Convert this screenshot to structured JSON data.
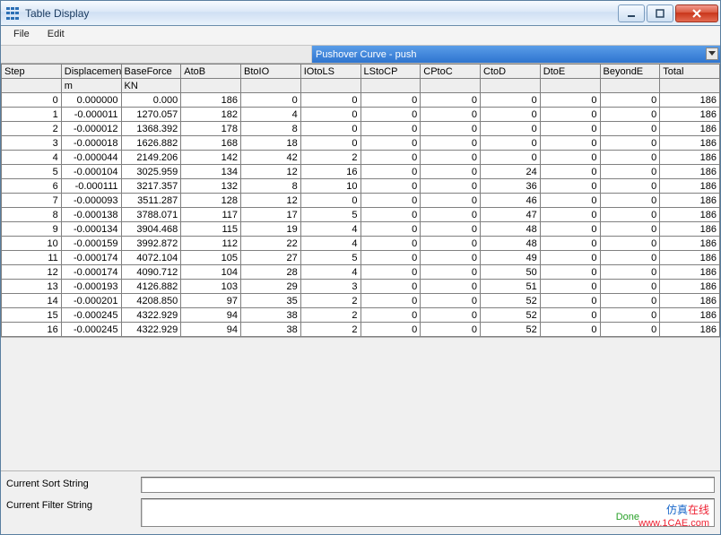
{
  "window": {
    "title": "Table Display"
  },
  "menu": {
    "file": "File",
    "edit": "Edit"
  },
  "selector": {
    "label": "Pushover Curve - push"
  },
  "columns": [
    "Step",
    "Displacemen",
    "BaseForce",
    "AtoB",
    "BtoIO",
    "IOtoLS",
    "LStoCP",
    "CPtoC",
    "CtoD",
    "DtoE",
    "BeyondE",
    "Total"
  ],
  "units": [
    "",
    "m",
    "KN",
    "",
    "",
    "",
    "",
    "",
    "",
    "",
    "",
    ""
  ],
  "rows": [
    [
      "0",
      "0.000000",
      "0.000",
      "186",
      "0",
      "0",
      "0",
      "0",
      "0",
      "0",
      "0",
      "186"
    ],
    [
      "1",
      "-0.000011",
      "1270.057",
      "182",
      "4",
      "0",
      "0",
      "0",
      "0",
      "0",
      "0",
      "186"
    ],
    [
      "2",
      "-0.000012",
      "1368.392",
      "178",
      "8",
      "0",
      "0",
      "0",
      "0",
      "0",
      "0",
      "186"
    ],
    [
      "3",
      "-0.000018",
      "1626.882",
      "168",
      "18",
      "0",
      "0",
      "0",
      "0",
      "0",
      "0",
      "186"
    ],
    [
      "4",
      "-0.000044",
      "2149.206",
      "142",
      "42",
      "2",
      "0",
      "0",
      "0",
      "0",
      "0",
      "186"
    ],
    [
      "5",
      "-0.000104",
      "3025.959",
      "134",
      "12",
      "16",
      "0",
      "0",
      "24",
      "0",
      "0",
      "186"
    ],
    [
      "6",
      "-0.000111",
      "3217.357",
      "132",
      "8",
      "10",
      "0",
      "0",
      "36",
      "0",
      "0",
      "186"
    ],
    [
      "7",
      "-0.000093",
      "3511.287",
      "128",
      "12",
      "0",
      "0",
      "0",
      "46",
      "0",
      "0",
      "186"
    ],
    [
      "8",
      "-0.000138",
      "3788.071",
      "117",
      "17",
      "5",
      "0",
      "0",
      "47",
      "0",
      "0",
      "186"
    ],
    [
      "9",
      "-0.000134",
      "3904.468",
      "115",
      "19",
      "4",
      "0",
      "0",
      "48",
      "0",
      "0",
      "186"
    ],
    [
      "10",
      "-0.000159",
      "3992.872",
      "112",
      "22",
      "4",
      "0",
      "0",
      "48",
      "0",
      "0",
      "186"
    ],
    [
      "11",
      "-0.000174",
      "4072.104",
      "105",
      "27",
      "5",
      "0",
      "0",
      "49",
      "0",
      "0",
      "186"
    ],
    [
      "12",
      "-0.000174",
      "4090.712",
      "104",
      "28",
      "4",
      "0",
      "0",
      "50",
      "0",
      "0",
      "186"
    ],
    [
      "13",
      "-0.000193",
      "4126.882",
      "103",
      "29",
      "3",
      "0",
      "0",
      "51",
      "0",
      "0",
      "186"
    ],
    [
      "14",
      "-0.000201",
      "4208.850",
      "97",
      "35",
      "2",
      "0",
      "0",
      "52",
      "0",
      "0",
      "186"
    ],
    [
      "15",
      "-0.000245",
      "4322.929",
      "94",
      "38",
      "2",
      "0",
      "0",
      "52",
      "0",
      "0",
      "186"
    ],
    [
      "16",
      "-0.000245",
      "4322.929",
      "94",
      "38",
      "2",
      "0",
      "0",
      "52",
      "0",
      "0",
      "186"
    ]
  ],
  "bottom": {
    "sort_label": "Current Sort String",
    "filter_label": "Current Filter String",
    "sort_value": "",
    "filter_value": ""
  },
  "status": {
    "done": "Done"
  },
  "watermark": {
    "line1_a": "仿真",
    "line1_b": "在线",
    "line2": "www.1CAE.com"
  },
  "chart_data": {
    "type": "table",
    "title": "Pushover Curve - push",
    "columns": [
      "Step",
      "Displacement (m)",
      "BaseForce (KN)",
      "AtoB",
      "BtoIO",
      "IOtoLS",
      "LStoCP",
      "CPtoC",
      "CtoD",
      "DtoE",
      "BeyondE",
      "Total"
    ],
    "data": [
      [
        0,
        0.0,
        0.0,
        186,
        0,
        0,
        0,
        0,
        0,
        0,
        0,
        186
      ],
      [
        1,
        -1.1e-05,
        1270.057,
        182,
        4,
        0,
        0,
        0,
        0,
        0,
        0,
        186
      ],
      [
        2,
        -1.2e-05,
        1368.392,
        178,
        8,
        0,
        0,
        0,
        0,
        0,
        0,
        186
      ],
      [
        3,
        -1.8e-05,
        1626.882,
        168,
        18,
        0,
        0,
        0,
        0,
        0,
        0,
        186
      ],
      [
        4,
        -4.4e-05,
        2149.206,
        142,
        42,
        2,
        0,
        0,
        0,
        0,
        0,
        186
      ],
      [
        5,
        -0.000104,
        3025.959,
        134,
        12,
        16,
        0,
        0,
        24,
        0,
        0,
        186
      ],
      [
        6,
        -0.000111,
        3217.357,
        132,
        8,
        10,
        0,
        0,
        36,
        0,
        0,
        186
      ],
      [
        7,
        -9.3e-05,
        3511.287,
        128,
        12,
        0,
        0,
        0,
        46,
        0,
        0,
        186
      ],
      [
        8,
        -0.000138,
        3788.071,
        117,
        17,
        5,
        0,
        0,
        47,
        0,
        0,
        186
      ],
      [
        9,
        -0.000134,
        3904.468,
        115,
        19,
        4,
        0,
        0,
        48,
        0,
        0,
        186
      ],
      [
        10,
        -0.000159,
        3992.872,
        112,
        22,
        4,
        0,
        0,
        48,
        0,
        0,
        186
      ],
      [
        11,
        -0.000174,
        4072.104,
        105,
        27,
        5,
        0,
        0,
        49,
        0,
        0,
        186
      ],
      [
        12,
        -0.000174,
        4090.712,
        104,
        28,
        4,
        0,
        0,
        50,
        0,
        0,
        186
      ],
      [
        13,
        -0.000193,
        4126.882,
        103,
        29,
        3,
        0,
        0,
        51,
        0,
        0,
        186
      ],
      [
        14,
        -0.000201,
        4208.85,
        97,
        35,
        2,
        0,
        0,
        52,
        0,
        0,
        186
      ],
      [
        15,
        -0.000245,
        4322.929,
        94,
        38,
        2,
        0,
        0,
        52,
        0,
        0,
        186
      ],
      [
        16,
        -0.000245,
        4322.929,
        94,
        38,
        2,
        0,
        0,
        52,
        0,
        0,
        186
      ]
    ]
  }
}
